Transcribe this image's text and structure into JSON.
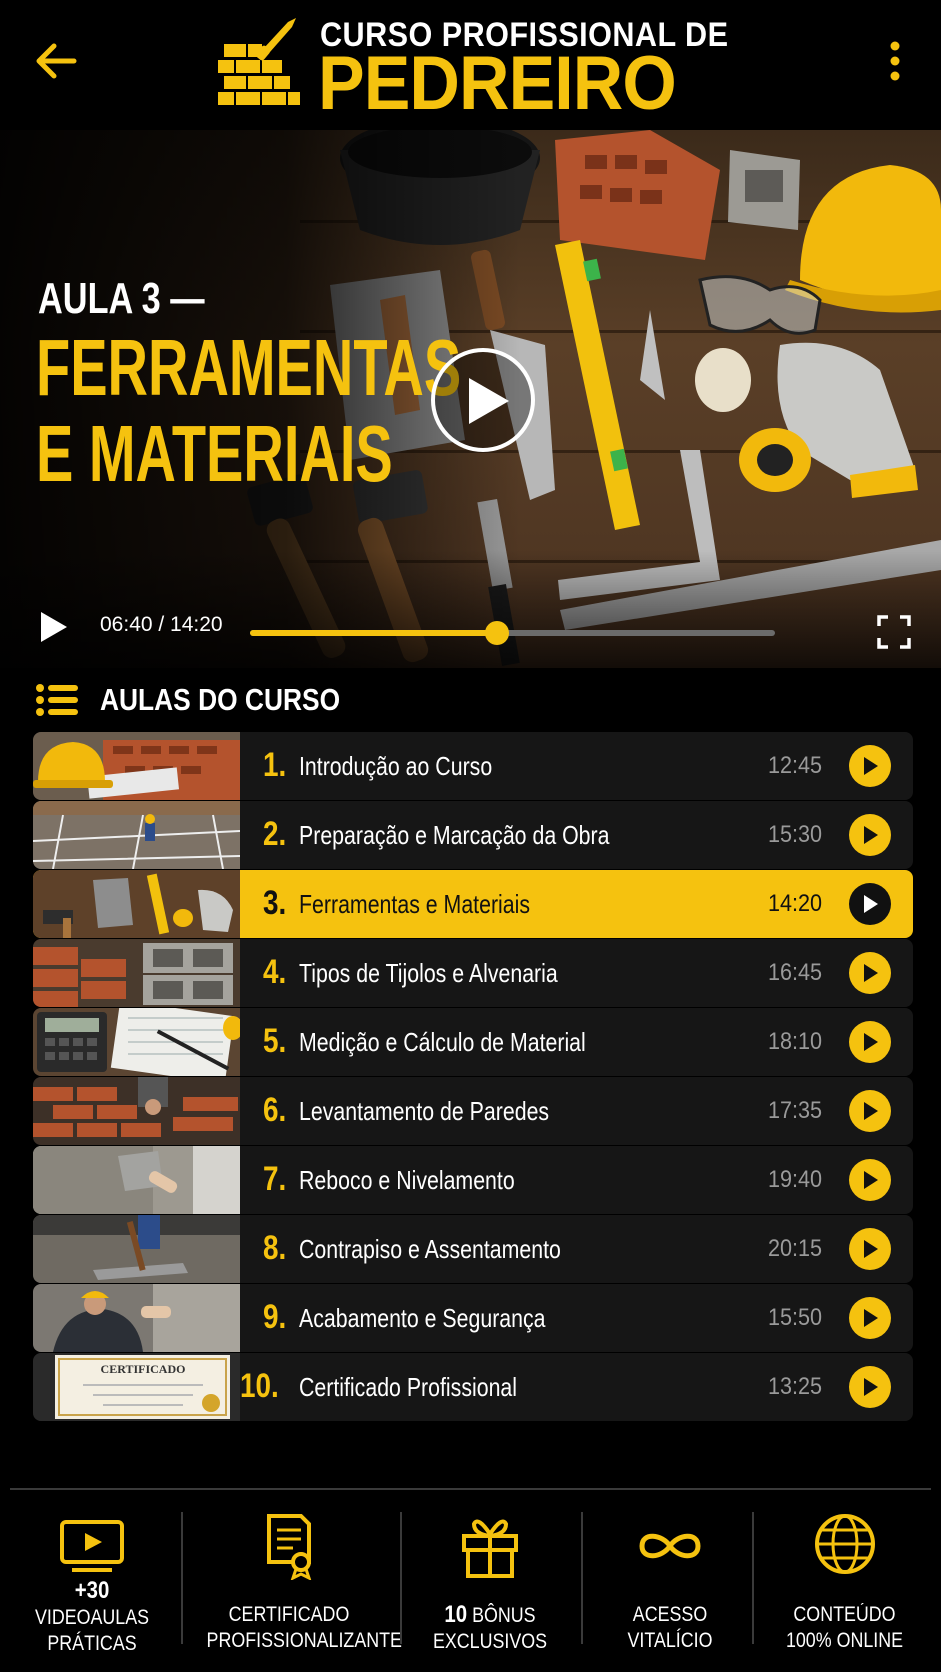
{
  "header": {
    "brand_line1": "CURSO PROFISSIONAL DE",
    "brand_line2": "PEDREIRO"
  },
  "player": {
    "lesson_label": "AULA 3 —",
    "lesson_title_line1": "FERRAMENTAS",
    "lesson_title_line2": "E MATERIAIS",
    "time": "06:40 / 14:20",
    "progress": 0.47
  },
  "lessons_section": {
    "title": "AULAS DO CURSO",
    "items": [
      {
        "num": "1.",
        "title": "Introdução ao Curso",
        "duration": "12:45",
        "active": false
      },
      {
        "num": "2.",
        "title": "Preparação e Marcação da Obra",
        "duration": "15:30",
        "active": false
      },
      {
        "num": "3.",
        "title": "Ferramentas e Materiais",
        "duration": "14:20",
        "active": true
      },
      {
        "num": "4.",
        "title": "Tipos de Tijolos e Alvenaria",
        "duration": "16:45",
        "active": false
      },
      {
        "num": "5.",
        "title": "Medição e Cálculo de Material",
        "duration": "18:10",
        "active": false
      },
      {
        "num": "6.",
        "title": "Levantamento de Paredes",
        "duration": "17:35",
        "active": false
      },
      {
        "num": "7.",
        "title": "Reboco e Nivelamento",
        "duration": "19:40",
        "active": false
      },
      {
        "num": "8.",
        "title": "Contrapiso e Assentamento",
        "duration": "20:15",
        "active": false
      },
      {
        "num": "9.",
        "title": "Acabamento e Segurança",
        "duration": "15:50",
        "active": false
      },
      {
        "num": "10.",
        "title": "Certificado Profissional",
        "duration": "13:25",
        "active": false
      }
    ],
    "certificate_thumb_text": "CERTIFICADO"
  },
  "features": [
    {
      "icon": "video-icon",
      "line1": "+30",
      "line2": "VIDEOAULAS",
      "line3": "PRÁTICAS"
    },
    {
      "icon": "certificate-icon",
      "line1": "CERTIFICADO",
      "line2": "PROFISSIONALIZANTE"
    },
    {
      "icon": "gift-icon",
      "line1_bold": "10",
      "line1_rest": " BÔNUS",
      "line2": "EXCLUSIVOS"
    },
    {
      "icon": "infinity-icon",
      "line1": "ACESSO",
      "line2": "VITALÍCIO"
    },
    {
      "icon": "globe-icon",
      "line1": "CONTEÚDO",
      "line2": "100% ONLINE"
    }
  ],
  "colors": {
    "accent": "#f5c20f",
    "background": "#000000",
    "row_background": "#161616",
    "muted_text": "#9a9a9a"
  }
}
